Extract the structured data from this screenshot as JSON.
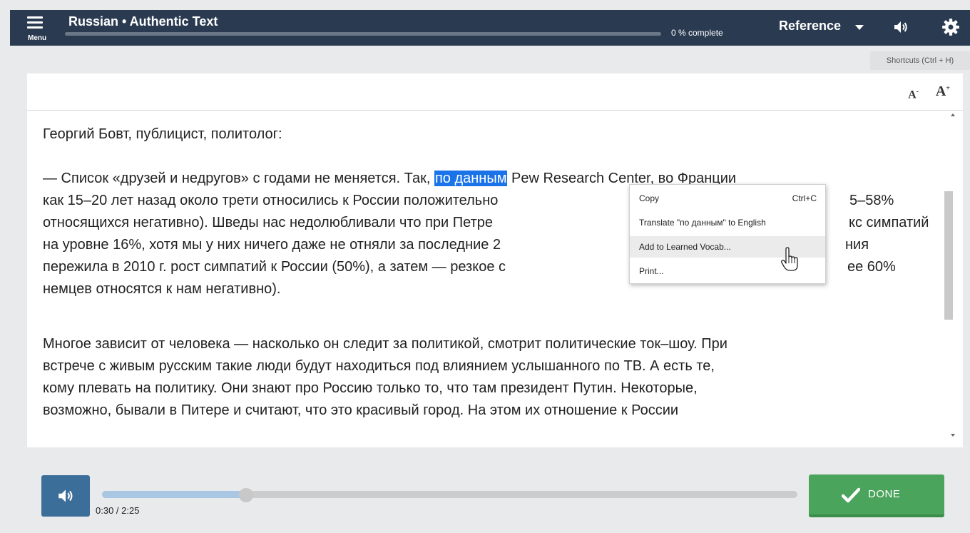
{
  "header": {
    "menu_label": "Menu",
    "title": "Russian • Authentic Text",
    "progress_text": "0 % complete",
    "progress_fraction": 0.0,
    "reference_label": "Reference",
    "shortcuts_label": "Shortcuts (Ctrl + H)"
  },
  "toolbar": {
    "font_decrease": "A",
    "font_decrease_sup": "-",
    "font_increase": "A",
    "font_increase_sup": "+"
  },
  "text": {
    "para1": "Георгий Бовт, публицист, политолог:",
    "para2": {
      "line1_before": "— Список «друзей и недругов» с годами не меняется. Так, ",
      "line1_highlight": "по данным",
      "line1_after": " Pew Research Center, во Франции",
      "line2": "как 15–20 лет назад около трети относились к России положительно",
      "line2_tail": "5–58%",
      "line3": "относящихся негативно). Шведы нас недолюбливали что при Петре",
      "line3_tail": "кс симпатий",
      "line4": "на уровне 16%, хотя мы у них ничего даже не отняли за последние 2",
      "line4_tail": "ния",
      "line5": "пережила в 2010 г. рост симпатий к России (50%), а затем — резкое с",
      "line5_tail": "ее 60%",
      "line6": "немцев относятся к нам негативно)."
    },
    "para3": {
      "line1": "Многое зависит от человека — насколько он следит за политикой, смотрит политические ток–шоу. При",
      "line2": "встрече с живым русским такие люди будут находиться под влиянием услышанного по ТВ. А есть те,",
      "line3": "кому плевать на политику. Они знают про Россию только то, что там президент Путин. Некоторые,",
      "line4": "возможно, бывали в Питере и считают, что это красивый город. На этом их отношение к России"
    }
  },
  "context_menu": {
    "items": [
      {
        "label": "Copy",
        "shortcut": "Ctrl+C"
      },
      {
        "label": "Translate \"по данным\" to English",
        "shortcut": ""
      },
      {
        "label": "Add to Learned Vocab...",
        "shortcut": ""
      },
      {
        "label": "Print...",
        "shortcut": ""
      }
    ],
    "hovered_index": 2
  },
  "player": {
    "time_text": "0:30 / 2:25",
    "position_seconds": 30,
    "duration_seconds": 145,
    "done_label": "DONE"
  },
  "colors": {
    "header_bg": "#2a3a51",
    "highlight": "#1a73e8",
    "audio_button": "#3c6e9a",
    "done_button": "#4aa45c"
  },
  "icons": [
    "menu-icon",
    "caret-down-icon",
    "speaker-icon",
    "gear-icon",
    "pointer-hand-icon",
    "checkmark-icon"
  ]
}
